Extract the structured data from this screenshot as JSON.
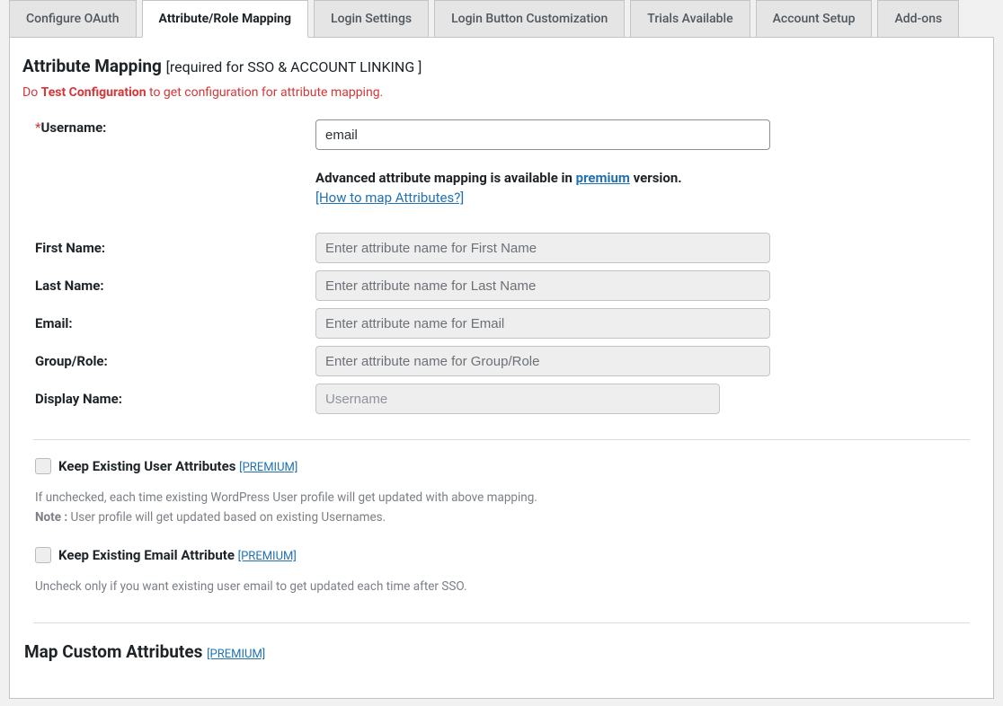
{
  "tabs": {
    "configure": "Configure OAuth",
    "mapping": "Attribute/Role Mapping",
    "login": "Login Settings",
    "button": "Login Button Customization",
    "trials": "Trials Available",
    "account": "Account Setup",
    "addons": "Add-ons"
  },
  "attr": {
    "title": "Attribute Mapping ",
    "title_sub": "[required for SSO & ACCOUNT LINKING ]",
    "alert_pre": "Do ",
    "alert_bold": "Test Configuration",
    "alert_post": " to get configuration for attribute mapping.",
    "username_label": "Username:",
    "username_value": "email",
    "hint_pre": "Advanced attribute mapping is available in ",
    "hint_link": "premium",
    "hint_post": " version.",
    "hint2_link": "[How to map Attributes?]",
    "first_name_label": "First Name:",
    "first_name_ph": "Enter attribute name for First Name",
    "last_name_label": "Last Name:",
    "last_name_ph": "Enter attribute name for Last Name",
    "email_label": "Email:",
    "email_ph": "Enter attribute name for Email",
    "group_label": "Group/Role:",
    "group_ph": "Enter attribute name for Group/Role",
    "display_label": "Display Name:",
    "display_ph": "Username"
  },
  "opts": {
    "keep_attr_label": "Keep Existing User Attributes",
    "premium_tag": "[PREMIUM]",
    "keep_attr_desc1": "If unchecked, each time existing WordPress User profile will get updated with above mapping.",
    "keep_attr_note": "Note :",
    "keep_attr_desc2": " User profile will get updated based on existing Usernames.",
    "keep_email_label": "Keep Existing Email Attribute",
    "keep_email_desc": "Uncheck only if you want existing user email to get updated each time after SSO."
  },
  "custom": {
    "title": "Map Custom Attributes "
  }
}
